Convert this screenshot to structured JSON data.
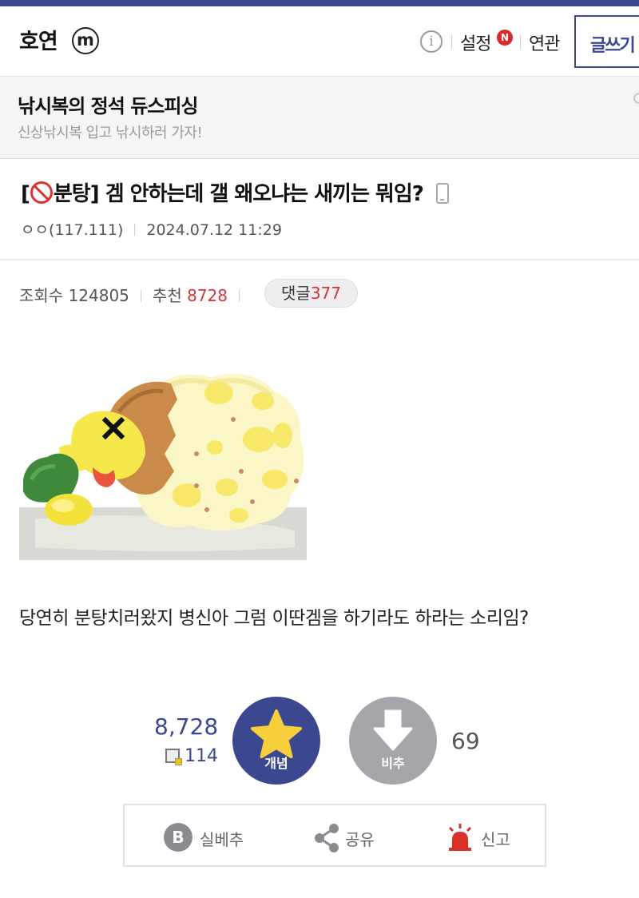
{
  "header": {
    "gallery_name": "호연",
    "minor_badge": "m",
    "info_icon": "i",
    "settings_label": "설정",
    "new_badge": "N",
    "related_label": "연관",
    "write_label": "글쓰기"
  },
  "ad": {
    "title": "낚시복의 정석 듀스피싱",
    "subtitle": "신상낚시복 입고 낚시하러 가자!"
  },
  "post": {
    "category_open": "[",
    "category": "분탕",
    "category_close": "]",
    "title": "겜 안하는데 갤 왜오냐는 새끼는 뭐임?",
    "author": "ㅇㅇ(117.111)",
    "date": "2024.07.12 11:29",
    "views_label": "조회수",
    "views": "124805",
    "recommend_label": "추천",
    "recommend": "8728",
    "comments_label": "댓글",
    "comments": "377",
    "body": "당연히 분탕치러왔지 병신아 그럼 이딴겜을 하기라도 하라는 소리임?"
  },
  "votes": {
    "up_count": "8,728",
    "fixed_count": "114",
    "up_label": "개념",
    "down_label": "비추",
    "down_count": "69"
  },
  "actions": {
    "silbe_label": "실베추",
    "share_label": "공유",
    "report_label": "신고"
  },
  "colors": {
    "accent": "#3b4890",
    "red": "#d2353b",
    "gray_button": "#a5a5ab"
  }
}
